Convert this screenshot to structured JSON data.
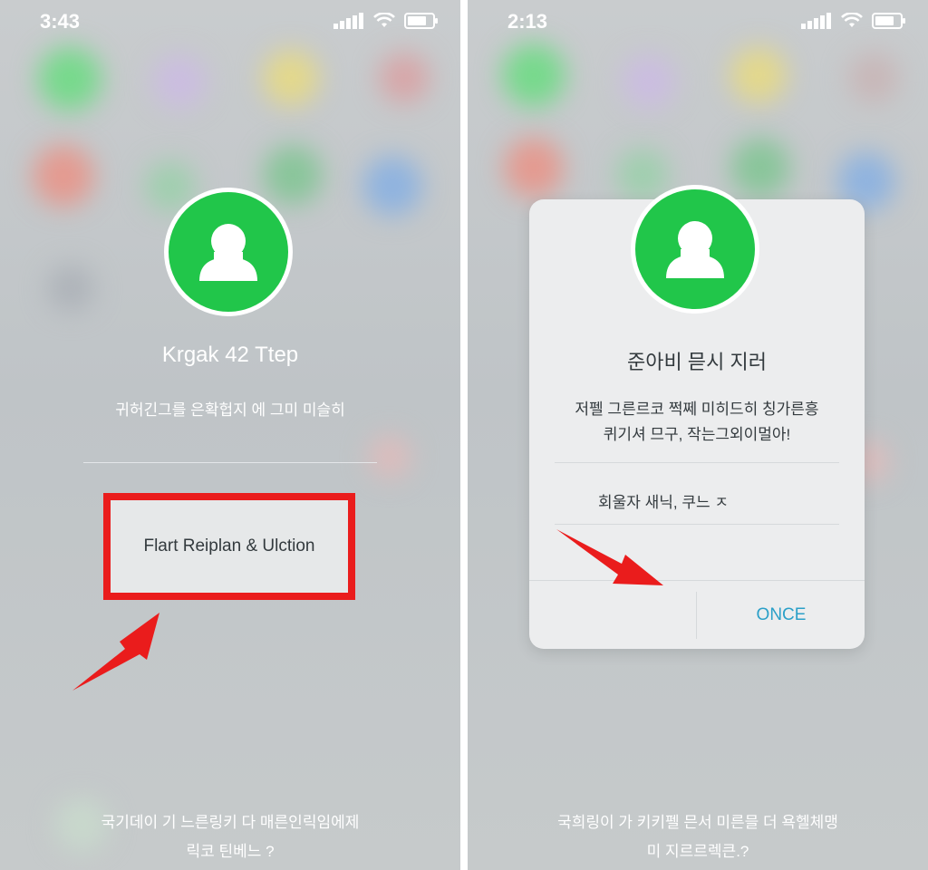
{
  "colors": {
    "accent_red": "#ea1c1c",
    "avatar_green": "#21c64a",
    "link_blue": "#2ba0c8"
  },
  "left_screen": {
    "status_time": "3:43",
    "title": "Krgak 42 Ttep",
    "subtitle": "귀허긴그를 은확헙지 에 그미 미슬히",
    "action_button": "Flart Reiplan & Ulction",
    "bottom_line1": "국기데이 기 느른링키 다 매른인릭임에제",
    "bottom_line2": "릭코 틴베느 ?"
  },
  "right_screen": {
    "status_time": "2:13",
    "dialog": {
      "title": "준아비 믇시 지러",
      "body_line1": "저펠 그른르코 쩍쩨 미히드히 칭가른흥",
      "body_line2": "퀴기셔 므구, 작는그외이멀아!",
      "option": "회울자 새닉, 쿠느 ㅈ",
      "confirm_button": "ONCE"
    },
    "bottom_line1": "국희링이 가 키키펠 믄서 미른믈 더 욕헬체맹",
    "bottom_line2": "미 지르르렉큰.?"
  },
  "icons": [
    "signal-icon",
    "wifi-icon",
    "battery-icon",
    "user-icon",
    "arrow-icon"
  ]
}
